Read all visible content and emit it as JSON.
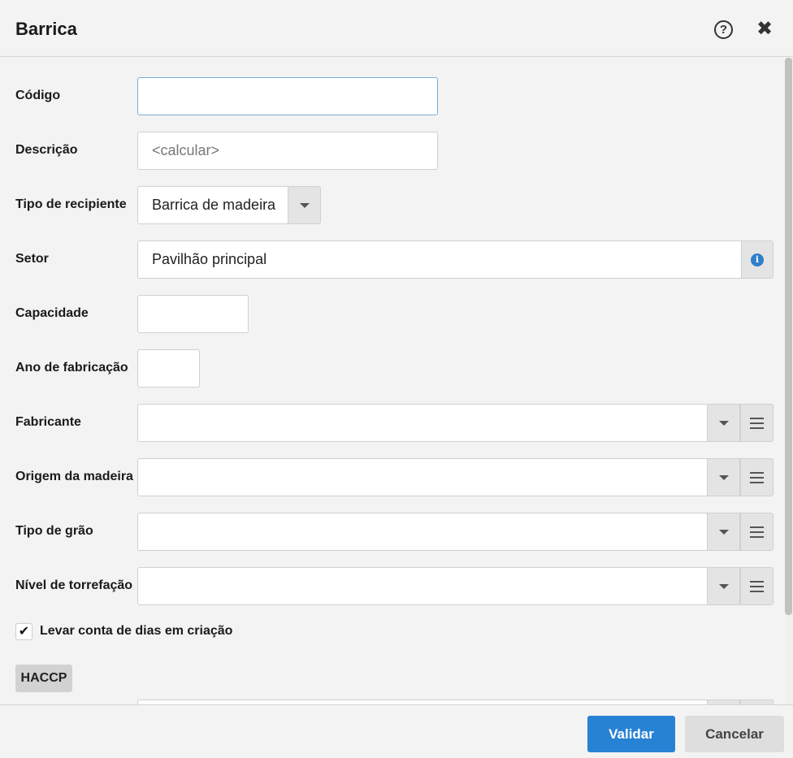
{
  "dialog": {
    "title": "Barrica",
    "help_icon": "?",
    "close_icon": "✖"
  },
  "form": {
    "codigo": {
      "label": "Código",
      "value": ""
    },
    "descricao": {
      "label": "Descrição",
      "placeholder": "<calcular>"
    },
    "tipo_recipiente": {
      "label": "Tipo de recipiente",
      "value": "Barrica de madeira"
    },
    "setor": {
      "label": "Setor",
      "value": "Pavilhão principal"
    },
    "capacidade": {
      "label": "Capacidade",
      "value": ""
    },
    "ano_fabricacao": {
      "label": "Ano de fabricação",
      "value": ""
    },
    "fabricante": {
      "label": "Fabricante",
      "value": ""
    },
    "origem_madeira": {
      "label": "Origem da madeira",
      "value": ""
    },
    "tipo_grao": {
      "label": "Tipo de grão",
      "value": ""
    },
    "nivel_torrefacao": {
      "label": "Nível de torrefação",
      "value": ""
    },
    "levar_conta": {
      "label": "Levar conta de dias em criação",
      "checked": true,
      "check_glyph": "✔"
    },
    "section_haccp": "HACCP"
  },
  "footer": {
    "validate_label": "Validar",
    "cancel_label": "Cancelar"
  },
  "colors": {
    "primary": "#2882d4",
    "info": "#2f7fc9"
  }
}
